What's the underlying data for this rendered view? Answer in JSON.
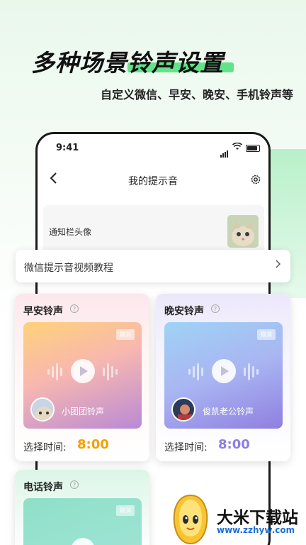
{
  "headline": "多种场景铃声设置",
  "subline": "自定义微信、早安、晚安、手机铃声等",
  "status": {
    "time": "9:41"
  },
  "nav": {
    "title": "我的提示音",
    "back_icon": "chevron-left-icon",
    "settings_icon": "gear-icon"
  },
  "notify_avatar": {
    "label": "通知栏头像"
  },
  "tutorial": {
    "label": "微信提示音视频教程"
  },
  "cards": {
    "morning": {
      "title": "早安铃声",
      "cancel": "取消",
      "ring_name": "小团团铃声",
      "time_label": "选择时间:",
      "time_value": "8:00"
    },
    "night": {
      "title": "晚安铃声",
      "cancel": "取消",
      "ring_name": "俊凯老公铃声",
      "time_label": "选择时间:",
      "time_value": "8:00"
    },
    "call": {
      "title": "电话铃声",
      "cancel": "取消"
    }
  },
  "watermark": {
    "title": "大米下载站",
    "url": "www.zzhyw.com"
  },
  "colors": {
    "accent_green": "#62e38a",
    "morning_time": "#f5a000",
    "night_time": "#8b7fe6"
  }
}
